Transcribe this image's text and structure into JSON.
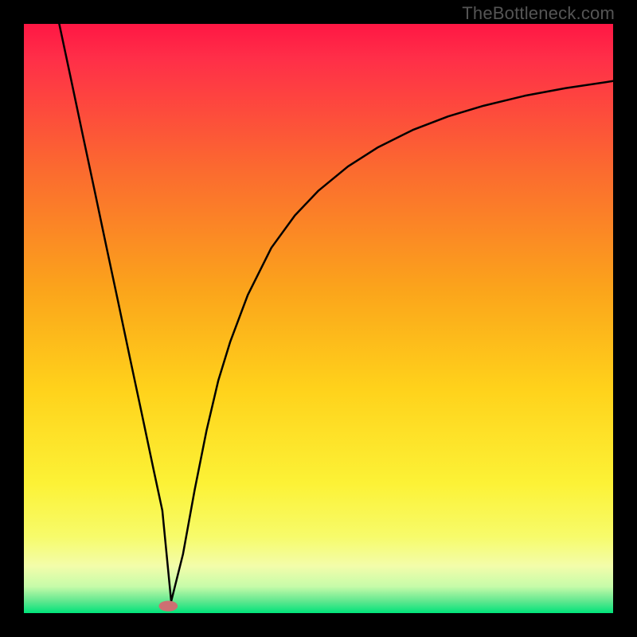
{
  "watermark_text": "TheBottleneck.com",
  "chart_data": {
    "type": "line",
    "title": "",
    "subtitle": "",
    "xlabel": "",
    "ylabel": "",
    "xlim": [
      0,
      100
    ],
    "ylim": [
      0,
      100
    ],
    "grid": false,
    "legend": false,
    "annotations": [],
    "gradient_stops": [
      {
        "offset": 0.0,
        "color": "#ff1744"
      },
      {
        "offset": 0.06,
        "color": "#ff2f48"
      },
      {
        "offset": 0.25,
        "color": "#fb6b2f"
      },
      {
        "offset": 0.45,
        "color": "#fba41b"
      },
      {
        "offset": 0.62,
        "color": "#ffd21b"
      },
      {
        "offset": 0.78,
        "color": "#fcf236"
      },
      {
        "offset": 0.87,
        "color": "#f7fb6a"
      },
      {
        "offset": 0.92,
        "color": "#f3fdaa"
      },
      {
        "offset": 0.955,
        "color": "#c6fba9"
      },
      {
        "offset": 0.98,
        "color": "#5fe78f"
      },
      {
        "offset": 1.0,
        "color": "#00e37a"
      }
    ],
    "series": [
      {
        "name": "bottleneck-curve",
        "color": "#000000",
        "x": [
          6,
          8,
          10,
          12,
          14,
          16,
          18,
          20,
          22,
          23.5,
          25,
          27,
          29,
          31,
          33,
          35,
          38,
          42,
          46,
          50,
          55,
          60,
          66,
          72,
          78,
          85,
          92,
          100
        ],
        "values": [
          100,
          90.6,
          81.1,
          71.7,
          62.2,
          52.8,
          43.3,
          33.9,
          24.4,
          17.4,
          2,
          10,
          21,
          31,
          39.5,
          46,
          54,
          62,
          67.5,
          71.7,
          75.8,
          79,
          82,
          84.3,
          86.1,
          87.8,
          89.1,
          90.3
        ]
      }
    ],
    "marker": {
      "name": "optimal-point",
      "color": "#cd6f72",
      "cx": 24.5,
      "cy": 1.2,
      "rx": 1.6,
      "ry": 0.9
    }
  }
}
